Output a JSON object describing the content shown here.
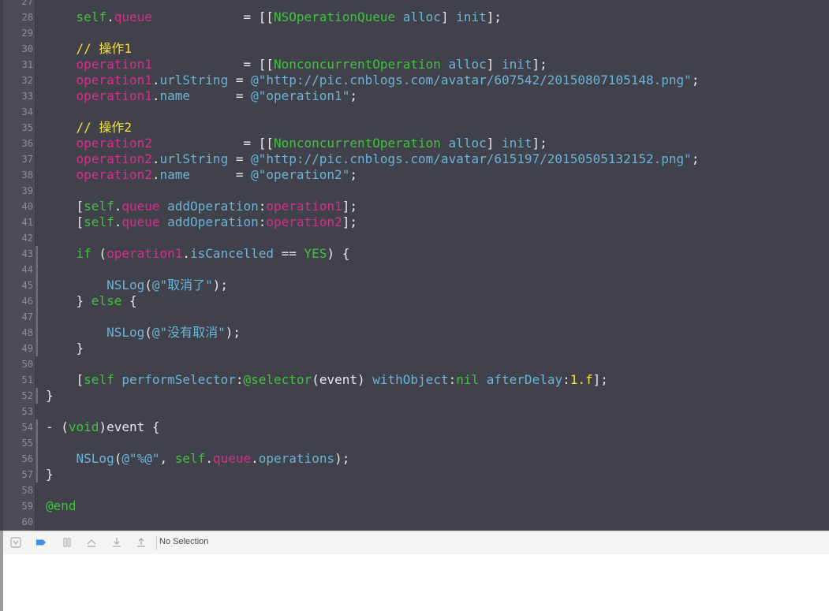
{
  "editor": {
    "lines": [
      {
        "n": "27",
        "tokens": []
      },
      {
        "n": "28",
        "tokens": [
          [
            "    ",
            "dl"
          ],
          [
            "self",
            "g"
          ],
          [
            ".",
            "dl"
          ],
          [
            "queue",
            "m"
          ],
          [
            "            = [[",
            "dl"
          ],
          [
            "NSOperationQueue",
            "g"
          ],
          [
            " ",
            "dl"
          ],
          [
            "alloc",
            "b"
          ],
          [
            "] ",
            "dl"
          ],
          [
            "init",
            "b"
          ],
          [
            "];",
            "dl"
          ]
        ]
      },
      {
        "n": "29",
        "tokens": []
      },
      {
        "n": "30",
        "tokens": [
          [
            "    // 操作1",
            "y"
          ]
        ]
      },
      {
        "n": "31",
        "tokens": [
          [
            "    ",
            "dl"
          ],
          [
            "operation1",
            "m"
          ],
          [
            "            = [[",
            "dl"
          ],
          [
            "NonconcurrentOperation",
            "g"
          ],
          [
            " ",
            "dl"
          ],
          [
            "alloc",
            "b"
          ],
          [
            "] ",
            "dl"
          ],
          [
            "init",
            "b"
          ],
          [
            "];",
            "dl"
          ]
        ]
      },
      {
        "n": "32",
        "tokens": [
          [
            "    ",
            "dl"
          ],
          [
            "operation1",
            "m"
          ],
          [
            ".",
            "dl"
          ],
          [
            "urlString",
            "b"
          ],
          [
            " = ",
            "dl"
          ],
          [
            "@\"http://pic.cnblogs.com/avatar/607542/20150807105148.png\"",
            "s"
          ],
          [
            ";",
            "dl"
          ]
        ]
      },
      {
        "n": "33",
        "tokens": [
          [
            "    ",
            "dl"
          ],
          [
            "operation1",
            "m"
          ],
          [
            ".",
            "dl"
          ],
          [
            "name",
            "b"
          ],
          [
            "      = ",
            "dl"
          ],
          [
            "@\"operation1\"",
            "s"
          ],
          [
            ";",
            "dl"
          ]
        ]
      },
      {
        "n": "34",
        "tokens": []
      },
      {
        "n": "35",
        "tokens": [
          [
            "    // 操作2",
            "y"
          ]
        ]
      },
      {
        "n": "36",
        "tokens": [
          [
            "    ",
            "dl"
          ],
          [
            "operation2",
            "m"
          ],
          [
            "            = [[",
            "dl"
          ],
          [
            "NonconcurrentOperation",
            "g"
          ],
          [
            " ",
            "dl"
          ],
          [
            "alloc",
            "b"
          ],
          [
            "] ",
            "dl"
          ],
          [
            "init",
            "b"
          ],
          [
            "];",
            "dl"
          ]
        ]
      },
      {
        "n": "37",
        "tokens": [
          [
            "    ",
            "dl"
          ],
          [
            "operation2",
            "m"
          ],
          [
            ".",
            "dl"
          ],
          [
            "urlString",
            "b"
          ],
          [
            " = ",
            "dl"
          ],
          [
            "@\"http://pic.cnblogs.com/avatar/615197/20150505132152.png\"",
            "s"
          ],
          [
            ";",
            "dl"
          ]
        ]
      },
      {
        "n": "38",
        "tokens": [
          [
            "    ",
            "dl"
          ],
          [
            "operation2",
            "m"
          ],
          [
            ".",
            "dl"
          ],
          [
            "name",
            "b"
          ],
          [
            "      = ",
            "dl"
          ],
          [
            "@\"operation2\"",
            "s"
          ],
          [
            ";",
            "dl"
          ]
        ]
      },
      {
        "n": "39",
        "tokens": []
      },
      {
        "n": "40",
        "tokens": [
          [
            "    [",
            "dl"
          ],
          [
            "self",
            "g"
          ],
          [
            ".",
            "dl"
          ],
          [
            "queue",
            "m"
          ],
          [
            " ",
            "dl"
          ],
          [
            "addOperation",
            "b"
          ],
          [
            ":",
            "dl"
          ],
          [
            "operation1",
            "m"
          ],
          [
            "];",
            "dl"
          ]
        ]
      },
      {
        "n": "41",
        "tokens": [
          [
            "    [",
            "dl"
          ],
          [
            "self",
            "g"
          ],
          [
            ".",
            "dl"
          ],
          [
            "queue",
            "m"
          ],
          [
            " ",
            "dl"
          ],
          [
            "addOperation",
            "b"
          ],
          [
            ":",
            "dl"
          ],
          [
            "operation2",
            "m"
          ],
          [
            "];",
            "dl"
          ]
        ]
      },
      {
        "n": "42",
        "tokens": []
      },
      {
        "n": "43",
        "tokens": [
          [
            "    ",
            "dl"
          ],
          [
            "if",
            "g"
          ],
          [
            " (",
            "dl"
          ],
          [
            "operation1",
            "m"
          ],
          [
            ".",
            "dl"
          ],
          [
            "isCancelled",
            "b"
          ],
          [
            " == ",
            "dl"
          ],
          [
            "YES",
            "g"
          ],
          [
            ") {",
            "dl"
          ]
        ]
      },
      {
        "n": "44",
        "tokens": []
      },
      {
        "n": "45",
        "tokens": [
          [
            "        ",
            "dl"
          ],
          [
            "NSLog",
            "b"
          ],
          [
            "(",
            "dl"
          ],
          [
            "@\"取消了\"",
            "s"
          ],
          [
            ");",
            "dl"
          ]
        ]
      },
      {
        "n": "46",
        "tokens": [
          [
            "    } ",
            "dl"
          ],
          [
            "else",
            "g"
          ],
          [
            " {",
            "dl"
          ]
        ]
      },
      {
        "n": "47",
        "tokens": []
      },
      {
        "n": "48",
        "tokens": [
          [
            "        ",
            "dl"
          ],
          [
            "NSLog",
            "b"
          ],
          [
            "(",
            "dl"
          ],
          [
            "@\"没有取消\"",
            "s"
          ],
          [
            ");",
            "dl"
          ]
        ]
      },
      {
        "n": "49",
        "tokens": [
          [
            "    }",
            "dl"
          ]
        ]
      },
      {
        "n": "50",
        "tokens": []
      },
      {
        "n": "51",
        "tokens": [
          [
            "    [",
            "dl"
          ],
          [
            "self",
            "g"
          ],
          [
            " ",
            "dl"
          ],
          [
            "performSelector",
            "b"
          ],
          [
            ":",
            "dl"
          ],
          [
            "@selector",
            "g"
          ],
          [
            "(event) ",
            "dl"
          ],
          [
            "withObject",
            "b"
          ],
          [
            ":",
            "dl"
          ],
          [
            "nil",
            "g"
          ],
          [
            " ",
            "dl"
          ],
          [
            "afterDelay",
            "b"
          ],
          [
            ":",
            "dl"
          ],
          [
            "1.f",
            "y"
          ],
          [
            "];",
            "dl"
          ]
        ]
      },
      {
        "n": "52",
        "tokens": [
          [
            "}",
            "dl"
          ]
        ]
      },
      {
        "n": "53",
        "tokens": []
      },
      {
        "n": "54",
        "tokens": [
          [
            "- (",
            "dl"
          ],
          [
            "void",
            "g"
          ],
          [
            ")event {",
            "dl"
          ]
        ]
      },
      {
        "n": "55",
        "tokens": []
      },
      {
        "n": "56",
        "tokens": [
          [
            "    ",
            "dl"
          ],
          [
            "NSLog",
            "b"
          ],
          [
            "(",
            "dl"
          ],
          [
            "@\"%@\"",
            "s"
          ],
          [
            ", ",
            "dl"
          ],
          [
            "self",
            "g"
          ],
          [
            ".",
            "dl"
          ],
          [
            "queue",
            "m"
          ],
          [
            ".",
            "dl"
          ],
          [
            "operations",
            "b"
          ],
          [
            ");",
            "dl"
          ]
        ]
      },
      {
        "n": "57",
        "tokens": [
          [
            "}",
            "dl"
          ]
        ]
      },
      {
        "n": "58",
        "tokens": []
      },
      {
        "n": "59",
        "tokens": [
          [
            "@end",
            "g"
          ]
        ]
      },
      {
        "n": "60",
        "tokens": []
      }
    ]
  },
  "debug_bar": {
    "icons": [
      "hide-console-icon",
      "breakpoints-icon",
      "pause-icon",
      "step-over-icon",
      "step-into-icon",
      "step-out-icon"
    ],
    "selection_label": "No Selection"
  },
  "colors": {
    "editor_bg": "#40414a",
    "keyword_green": "#40c23e",
    "property_magenta": "#d62e8b",
    "method_blue": "#6cb3d8",
    "comment_yellow": "#f4e03a"
  }
}
